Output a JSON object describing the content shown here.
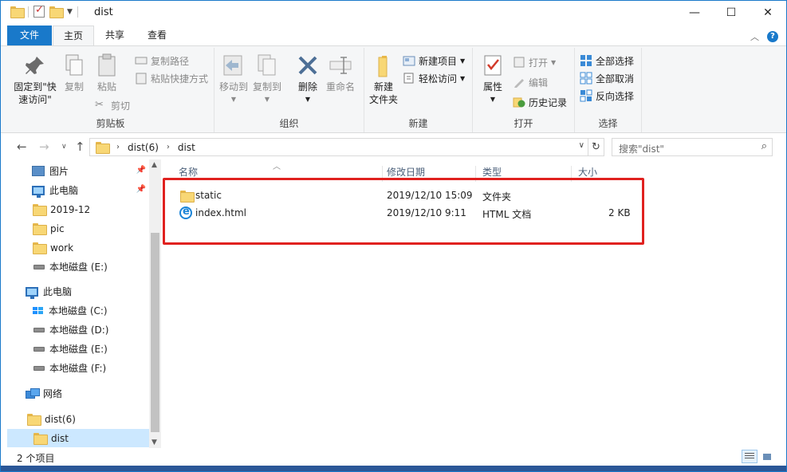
{
  "window": {
    "title": "dist",
    "minimize": "—",
    "maximize": "☐",
    "close": "✕"
  },
  "ribbon_tabs": {
    "file": "文件",
    "home": "主页",
    "share": "共享",
    "view": "查看"
  },
  "ribbon": {
    "clipboard": {
      "label": "剪贴板",
      "pin": "固定到\"快",
      "pin2": "速访问\"",
      "copy": "复制",
      "paste": "粘贴",
      "copy_path": "复制路径",
      "paste_shortcut": "粘贴快捷方式",
      "cut": "剪切"
    },
    "organize": {
      "label": "组织",
      "move_to": "移动到",
      "copy_to": "复制到",
      "delete": "删除",
      "rename": "重命名"
    },
    "new": {
      "label": "新建",
      "new_folder": "新建",
      "new_folder2": "文件夹",
      "new_item": "新建项目",
      "easy_access": "轻松访问"
    },
    "open": {
      "label": "打开",
      "properties": "属性",
      "open": "打开",
      "edit": "编辑",
      "history": "历史记录"
    },
    "select": {
      "label": "选择",
      "select_all": "全部选择",
      "select_none": "全部取消",
      "invert": "反向选择"
    }
  },
  "address": {
    "crumbs": [
      "dist(6)",
      "dist"
    ],
    "search_placeholder": "搜索\"dist\""
  },
  "nav_pane": {
    "items": [
      {
        "label": "图片",
        "pinned": true
      },
      {
        "label": "此电脑",
        "pinned": true
      },
      {
        "label": "2019-12"
      },
      {
        "label": "pic"
      },
      {
        "label": "work"
      },
      {
        "label": "本地磁盘 (E:)"
      },
      {
        "label": "此电脑"
      },
      {
        "label": "本地磁盘 (C:)"
      },
      {
        "label": "本地磁盘 (D:)"
      },
      {
        "label": "本地磁盘 (E:)"
      },
      {
        "label": "本地磁盘 (F:)"
      },
      {
        "label": "网络"
      },
      {
        "label": "dist(6)"
      },
      {
        "label": "dist",
        "selected": true
      }
    ]
  },
  "file_list": {
    "columns": [
      "名称",
      "修改日期",
      "类型",
      "大小"
    ],
    "rows": [
      {
        "name": "static",
        "modified": "2019/12/10 15:09",
        "type": "文件夹",
        "size": ""
      },
      {
        "name": "index.html",
        "modified": "2019/12/10 9:11",
        "type": "HTML 文档",
        "size": "2 KB"
      }
    ]
  },
  "status": {
    "item_count": "2 个项目"
  },
  "colors": {
    "accent": "#1979ca",
    "highlight_box": "#e0211f",
    "selected_bg": "#cce8ff"
  }
}
